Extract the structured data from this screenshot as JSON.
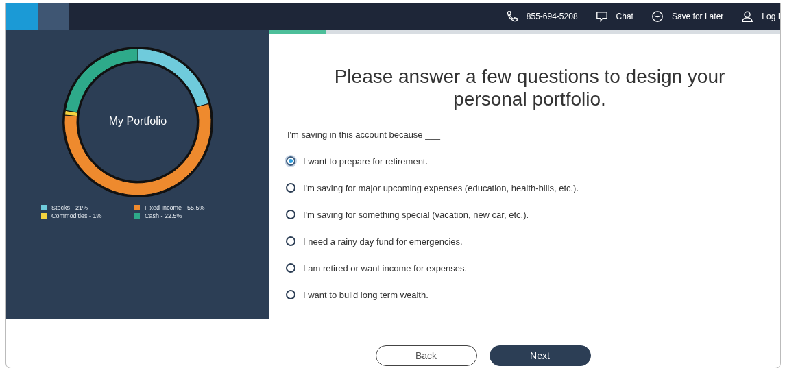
{
  "header": {
    "phone": "855-694-5208",
    "chat": "Chat",
    "save": "Save for Later",
    "login": "Log I"
  },
  "progress": {
    "level": 0.11
  },
  "portfolio": {
    "title": "My Portfolio",
    "chart_data": {
      "type": "donut",
      "values": [
        21,
        55.5,
        1,
        22.5
      ]
    },
    "legend": [
      {
        "label": "Stocks - 21%",
        "color": "#6fcbdc"
      },
      {
        "label": "Fixed Income - 55.5%",
        "color": "#ee8a2e"
      },
      {
        "label": "Commodities - 1%",
        "color": "#f5d33f"
      },
      {
        "label": "Cash - 22.5%",
        "color": "#2eaa8a"
      }
    ]
  },
  "question": {
    "heading": "Please answer a few questions to design your personal portfolio.",
    "prompt": "I'm saving in this account because ___",
    "options": [
      {
        "label": "I want to prepare for retirement.",
        "selected": true
      },
      {
        "label": "I'm saving for major upcoming expenses (education, health-bills, etc.).",
        "selected": false
      },
      {
        "label": "I'm saving for something special (vacation, new car, etc.).",
        "selected": false
      },
      {
        "label": "I need a rainy day fund for emergencies.",
        "selected": false
      },
      {
        "label": "I am retired or want income for expenses.",
        "selected": false
      },
      {
        "label": "I want to build long term wealth.",
        "selected": false
      }
    ]
  },
  "buttons": {
    "back": "Back",
    "next": "Next"
  }
}
